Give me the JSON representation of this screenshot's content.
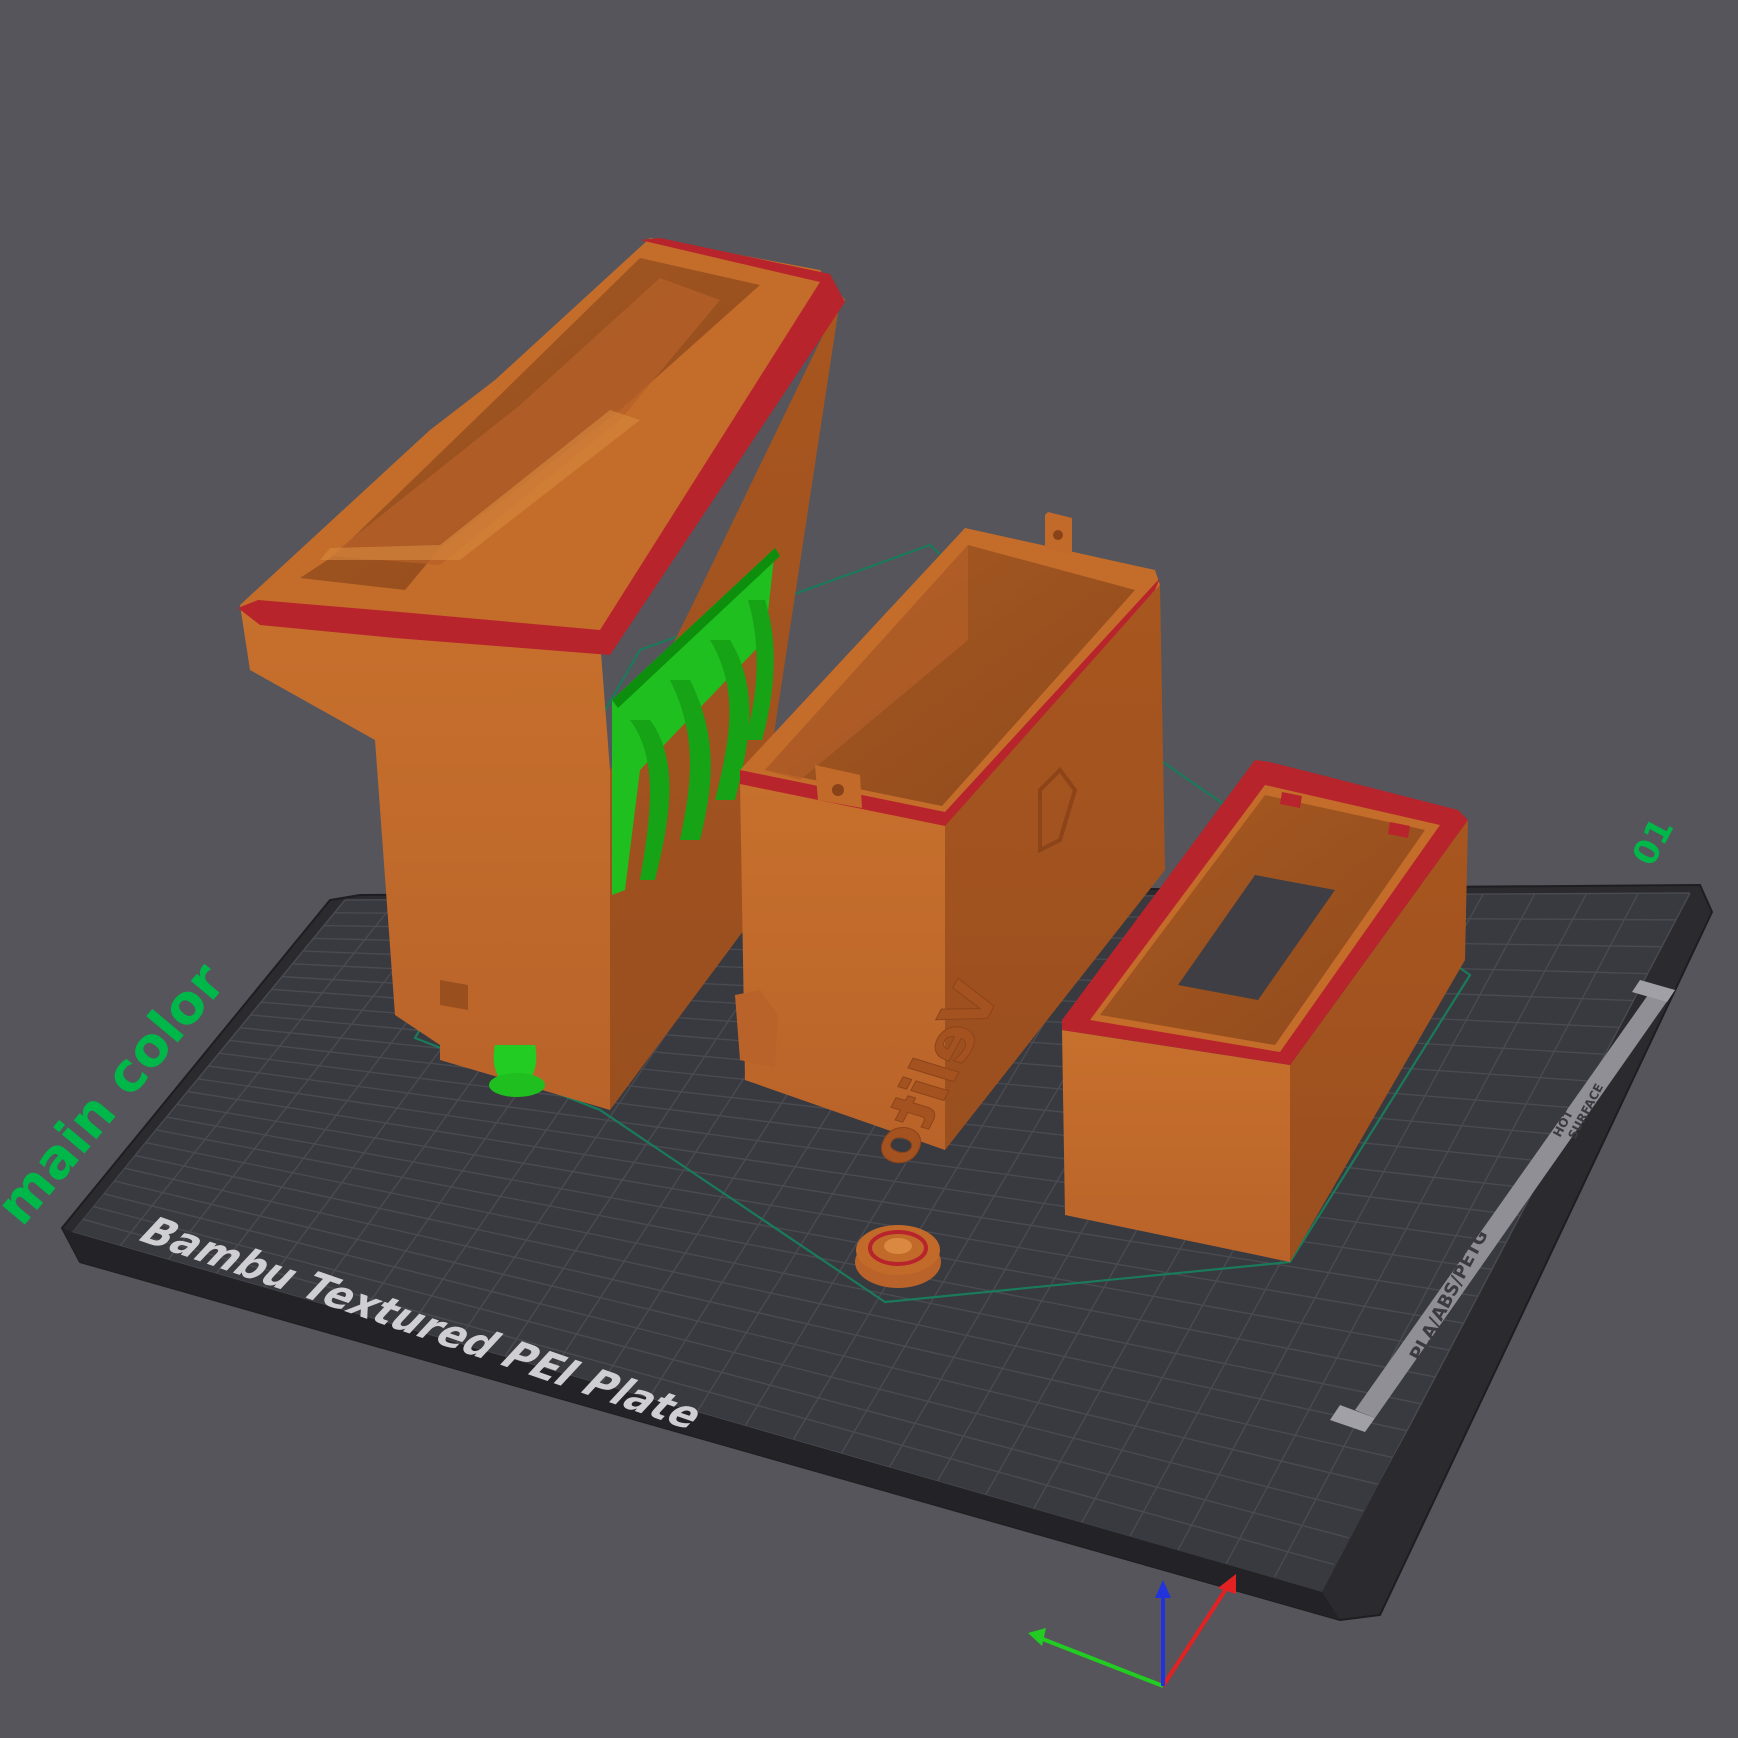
{
  "viewport": {
    "background_color": "#55555b"
  },
  "plate": {
    "name_text": "Bambu Textured PEI Plate",
    "plate_number_text": "01",
    "side_label_text": "main color",
    "strip_material_text": "PLA/ABS/PETG",
    "strip_hot_line1": "HOT",
    "strip_hot_line2": "SURFACE",
    "surface_color": "#3a3a40",
    "frame_color": "#2c2c30",
    "grid_color": "#4b4b52",
    "label_color": "#00b84a"
  },
  "models": {
    "filament_color": "#c26a2a",
    "top_layer_color": "#b8242c",
    "support_color": "#22cc22",
    "skirt_color": "#1a7a5a",
    "logo_text": "Velito"
  },
  "axes": {
    "x_color": "#e22222",
    "y_color": "#22cc22",
    "z_color": "#2233dd"
  }
}
